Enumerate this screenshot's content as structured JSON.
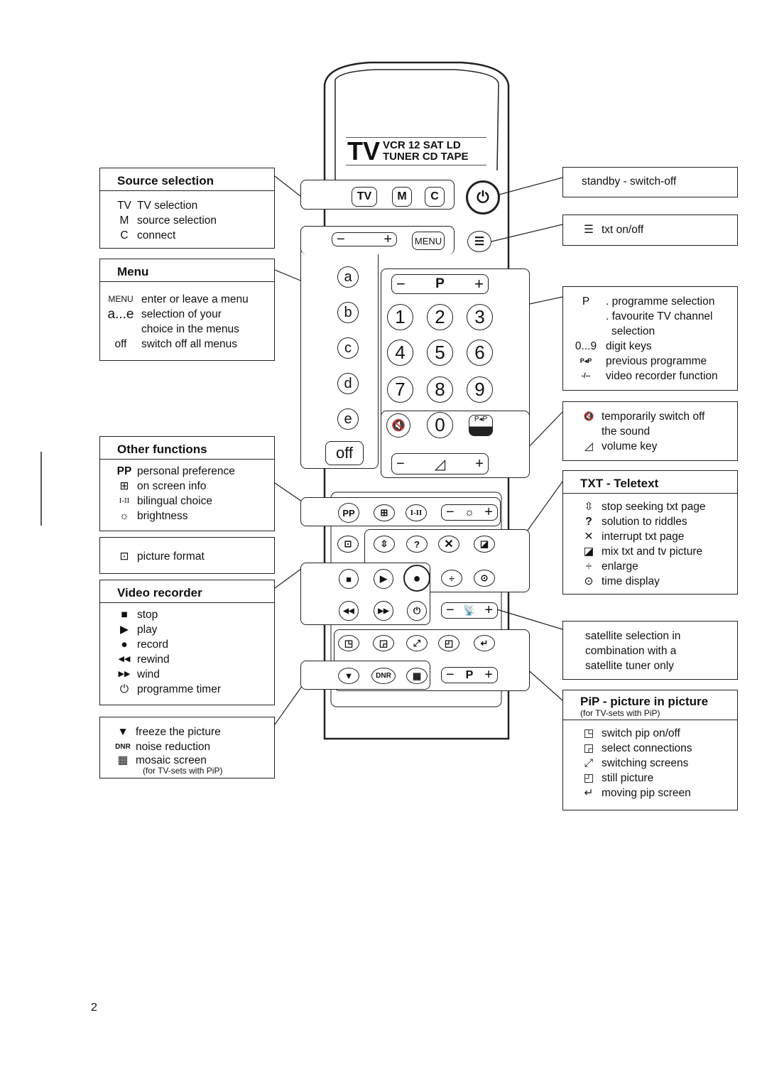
{
  "remote": {
    "display": {
      "big": "TV",
      "line1": "VCR 12  SAT  LD",
      "line2": "TUNER CD TAPE"
    },
    "buttons": {
      "tv": "TV",
      "m": "M",
      "c": "C",
      "menu": "MENU",
      "minus": "−",
      "plus": "+",
      "p": "P",
      "letters": [
        "a",
        "b",
        "c",
        "d",
        "e"
      ],
      "off": "off",
      "digits": [
        "1",
        "2",
        "3",
        "4",
        "5",
        "6",
        "7",
        "8",
        "9"
      ],
      "zero": "0",
      "pp_prev": "P◂P",
      "pp": "PP",
      "i_ii": "I-II",
      "dnr": "DNR",
      "question": "?"
    }
  },
  "left": {
    "source": {
      "title": "Source selection",
      "items": [
        {
          "k": "TV",
          "v": "TV selection"
        },
        {
          "k": "M",
          "v": "source selection"
        },
        {
          "k": "C",
          "v": "connect"
        }
      ]
    },
    "menu": {
      "title": "Menu",
      "items": [
        {
          "k": "MENU",
          "v": "enter or leave a menu"
        },
        {
          "k": "a...e",
          "v": "selection of your"
        },
        {
          "k": "",
          "v": "choice in the menus"
        },
        {
          "k": "off",
          "v": "switch off all menus"
        }
      ]
    },
    "other": {
      "title": "Other functions",
      "items": [
        {
          "k": "PP",
          "v": "personal preference"
        },
        {
          "k": "⊞",
          "v": "on screen info"
        },
        {
          "k": "I-II",
          "v": "bilingual choice"
        },
        {
          "k": "☼",
          "v": "brightness"
        }
      ]
    },
    "format": {
      "k": "⊡",
      "v": "picture format"
    },
    "video": {
      "title": "Video recorder",
      "items": [
        {
          "k": "■",
          "v": "stop"
        },
        {
          "k": "▶",
          "v": "play"
        },
        {
          "k": "●",
          "v": "record"
        },
        {
          "k": "◀◀",
          "v": "rewind"
        },
        {
          "k": "▶▶",
          "v": "wind"
        },
        {
          "k": "⏻",
          "v": "programme timer"
        }
      ]
    },
    "freeze": {
      "items": [
        {
          "k": "▼",
          "v": "freeze the picture"
        },
        {
          "k": "DNR",
          "v": "noise reduction"
        },
        {
          "k": "▦",
          "v": "mosaic screen"
        }
      ],
      "note": "(for TV-sets with PiP)"
    }
  },
  "right": {
    "standby": {
      "v": "standby - switch-off"
    },
    "txt": {
      "k": "☰",
      "v": "txt on/off"
    },
    "prog": {
      "items": [
        {
          "k": "P",
          "v": ". programme selection"
        },
        {
          "k": "",
          "v": ". favourite TV channel"
        },
        {
          "k": "",
          "v": "selection"
        },
        {
          "k": "0...9",
          "v": "digit keys"
        },
        {
          "k": "P◂P",
          "v": "previous programme"
        },
        {
          "k": "-/--",
          "v": "video recorder function"
        }
      ]
    },
    "sound": {
      "items": [
        {
          "k": "🔇",
          "v": "temporarily switch off"
        },
        {
          "k": "",
          "v": "the sound"
        },
        {
          "k": "◿",
          "v": "volume key"
        }
      ]
    },
    "teletext": {
      "title": "TXT - Teletext",
      "items": [
        {
          "k": "⇳",
          "v": "stop seeking txt page"
        },
        {
          "k": "?",
          "v": "solution to riddles"
        },
        {
          "k": "✕",
          "v": "interrupt txt page"
        },
        {
          "k": "◪",
          "v": "mix txt and tv picture"
        },
        {
          "k": "÷",
          "v": "enlarge"
        },
        {
          "k": "⊙",
          "v": "time display"
        }
      ]
    },
    "satellite": {
      "lines": [
        "satellite selection in",
        "combination with a",
        "satellite tuner only"
      ]
    },
    "pip": {
      "title": "PiP - picture in picture",
      "note": "(for TV-sets with PiP)",
      "items": [
        {
          "k": "◳",
          "v": "switch pip on/off"
        },
        {
          "k": "◲",
          "v": "select connections"
        },
        {
          "k": "⤢",
          "v": "switching screens"
        },
        {
          "k": "◰",
          "v": "still picture"
        },
        {
          "k": "↵",
          "v": "moving pip screen"
        }
      ]
    }
  },
  "page_number": "2"
}
